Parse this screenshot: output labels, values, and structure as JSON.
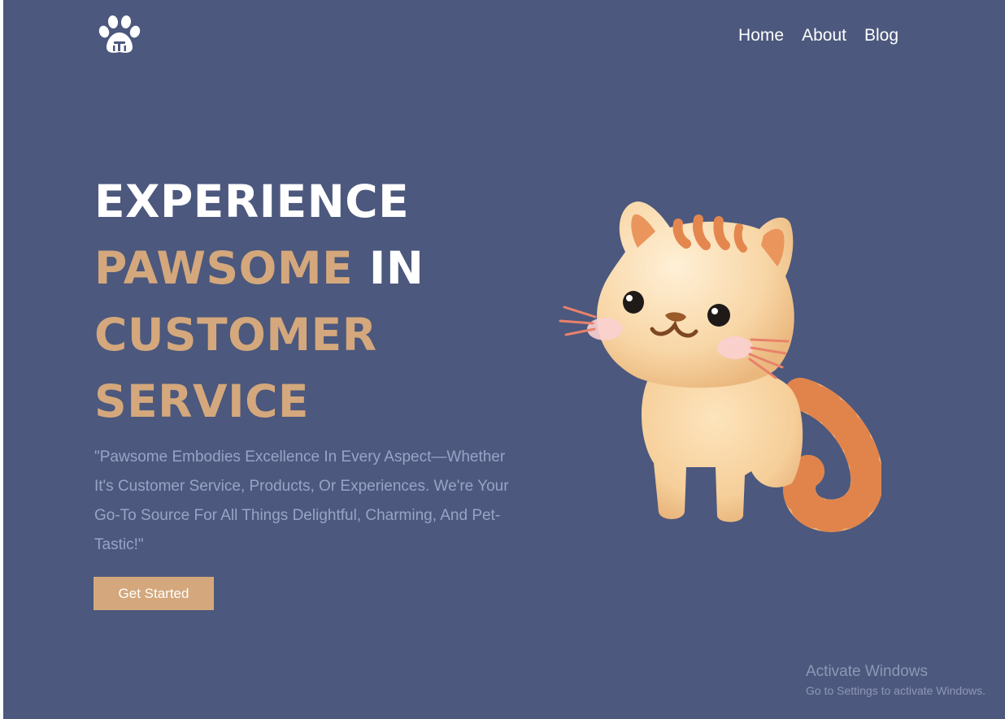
{
  "header": {
    "logo_icon": "paw-icon",
    "nav": {
      "home": "Home",
      "about": "About",
      "blog": "Blog"
    }
  },
  "hero": {
    "headline": {
      "line1": "EXPERIENCE",
      "line2_accent": "PAWSOME",
      "line2_rest": " IN",
      "line3": "CUSTOMER",
      "line4": "SERVICE"
    },
    "description": "\"Pawsome Embodies Excellence In Every Aspect—Whether It's Customer Service, Products, Or Experiences. We're Your Go-To Source For All Things Delightful, Charming, And Pet-Tastic!\"",
    "cta_label": "Get Started",
    "illustration": "cat-illustration"
  },
  "watermark": {
    "title": "Activate Windows",
    "subtitle": "Go to Settings to activate Windows."
  },
  "colors": {
    "background": "#4c587d",
    "accent": "#d4a87c",
    "text_light": "#ffffff",
    "text_muted": "#98a3c6"
  }
}
